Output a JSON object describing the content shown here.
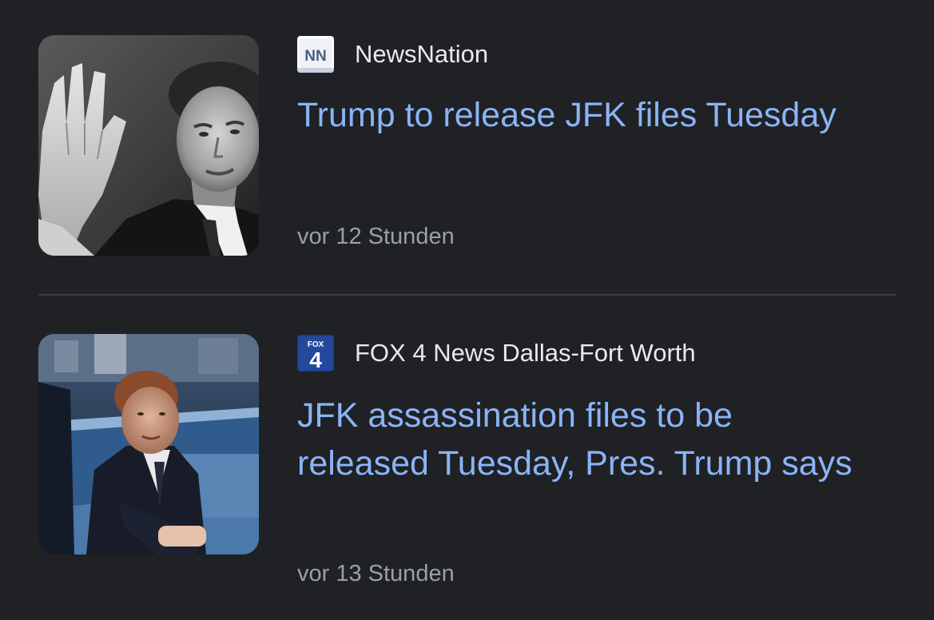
{
  "articles": [
    {
      "source": "NewsNation",
      "logo_text": "NN",
      "logo_icon": "newsnation-logo-icon",
      "headline": "Trump to release JFK files Tuesday",
      "time": "vor 12 Stunden",
      "thumbnail": "jfk-raised-hand-photo"
    },
    {
      "source": "FOX 4 News Dallas-Fort Worth",
      "logo_text": "4",
      "logo_small_text": "FOX",
      "logo_icon": "fox4-logo-icon",
      "headline": "JFK assassination files to be released Tuesday, Pres. Trump says",
      "time": "vor 13 Stunden",
      "thumbnail": "jfk-in-motorcade-car-photo"
    }
  ],
  "colors": {
    "background": "#202124",
    "headline": "#8ab4f8",
    "source": "#e8eaed",
    "timestamp": "#9aa0a6",
    "divider": "#3c4043"
  }
}
